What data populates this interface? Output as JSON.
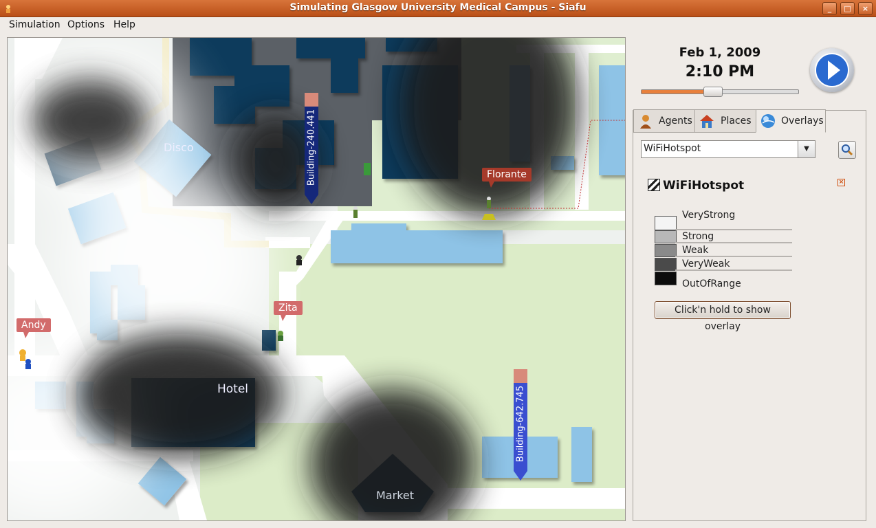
{
  "window": {
    "title": "Simulating Glasgow University Medical Campus - Siafu",
    "minimize_label": "_",
    "maximize_label": "□",
    "close_label": "×"
  },
  "menu": {
    "simulation": "Simulation",
    "options": "Options",
    "help": "Help"
  },
  "map": {
    "places": {
      "disco": "Disco",
      "hotel": "Hotel",
      "market": "Market"
    },
    "agents": {
      "florante": "Florante",
      "zita": "Zita",
      "andy": "Andy"
    },
    "pins": {
      "building_a": "Building-240.441",
      "building_b": "Building-642.745"
    }
  },
  "clock": {
    "date": "Feb 1, 2009",
    "time": "2:10 PM",
    "speed_fraction": 0.45
  },
  "tabs": {
    "agents": "Agents",
    "places": "Places",
    "overlays": "Overlays"
  },
  "overlays": {
    "selected": "WiFiHotspot",
    "title": "WiFiHotspot",
    "legend": [
      {
        "label": "VeryStrong",
        "color": "#f4f4f4"
      },
      {
        "label": "Strong",
        "color": "#b8b8b8"
      },
      {
        "label": "Weak",
        "color": "#8a8a8a"
      },
      {
        "label": "VeryWeak",
        "color": "#4a4a4a"
      },
      {
        "label": "OutOfRange",
        "color": "#0c0c0c"
      }
    ],
    "show_button": "Click'n hold to show overlay"
  },
  "colors": {
    "title_bar": "#c45e22",
    "building": "#0b3a5c",
    "building_light": "#8ec3e6",
    "grass": "#dfeed0",
    "road": "#ffffff",
    "accent": "#e8803c"
  }
}
